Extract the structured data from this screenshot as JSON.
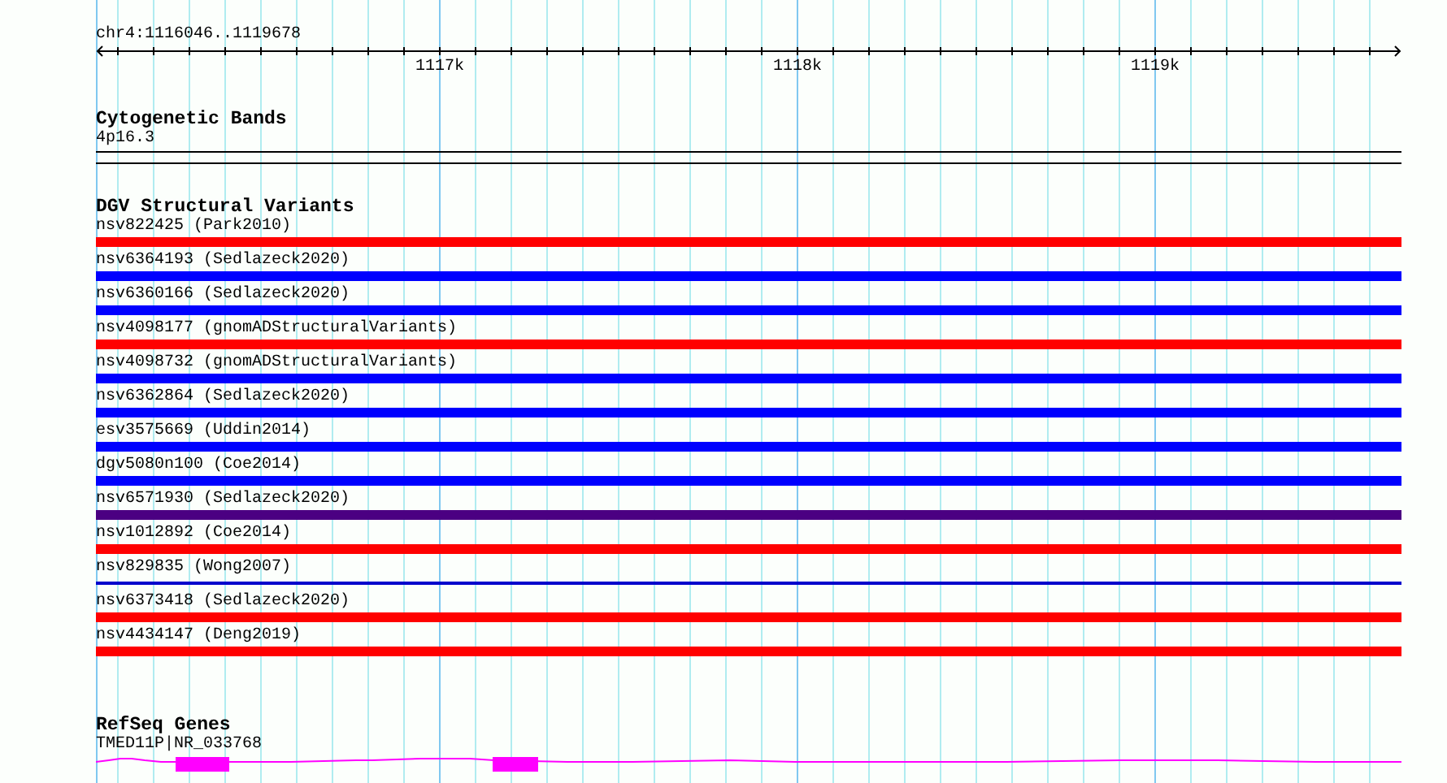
{
  "ruler": {
    "region": "chr4:1116046..1119678",
    "ticks": [
      "1117k",
      "1118k",
      "1119k"
    ]
  },
  "cytogenetic_bands": {
    "title": "Cytogenetic Bands",
    "band": "4p16.3"
  },
  "structural_variants": {
    "title": "DGV Structural Variants",
    "items": [
      {
        "label": "nsv822425 (Park2010)",
        "color": "#ff0000",
        "kind": "bar"
      },
      {
        "label": "nsv6364193 (Sedlazeck2020)",
        "color": "#0000ff",
        "kind": "bar"
      },
      {
        "label": "nsv6360166 (Sedlazeck2020)",
        "color": "#0000ff",
        "kind": "bar"
      },
      {
        "label": "nsv4098177 (gnomADStructuralVariants)",
        "color": "#ff0000",
        "kind": "bar"
      },
      {
        "label": "nsv4098732 (gnomADStructuralVariants)",
        "color": "#0000ff",
        "kind": "bar"
      },
      {
        "label": "nsv6362864 (Sedlazeck2020)",
        "color": "#0000ff",
        "kind": "bar"
      },
      {
        "label": "esv3575669 (Uddin2014)",
        "color": "#0000ff",
        "kind": "bar"
      },
      {
        "label": "dgv5080n100 (Coe2014)",
        "color": "#0000ff",
        "kind": "bar"
      },
      {
        "label": "nsv6571930 (Sedlazeck2020)",
        "color": "#4b0082",
        "kind": "bar"
      },
      {
        "label": "nsv1012892 (Coe2014)",
        "color": "#ff0000",
        "kind": "bar"
      },
      {
        "label": "nsv829835 (Wong2007)",
        "color": "#0000cc",
        "kind": "line"
      },
      {
        "label": "nsv6373418 (Sedlazeck2020)",
        "color": "#ff0000",
        "kind": "bar"
      },
      {
        "label": "nsv4434147 (Deng2019)",
        "color": "#ff0000",
        "kind": "bar"
      }
    ]
  },
  "refseq_genes": {
    "title": "RefSeq Genes",
    "gene": "TMED11P|NR_033768"
  }
}
